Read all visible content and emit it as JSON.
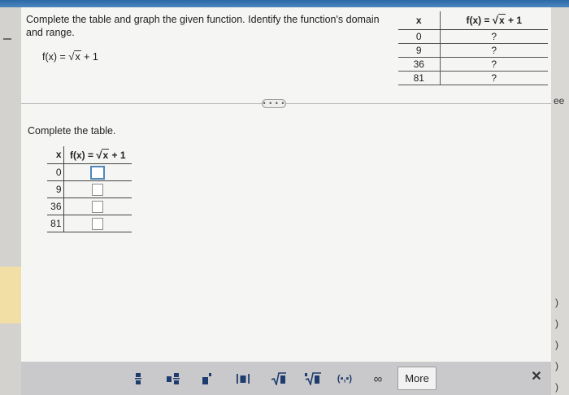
{
  "question": {
    "prompt": "Complete the table and graph the given function. Identify the function's domain and range.",
    "function_prefix": "f(x) = ",
    "function_radicand": "x",
    "function_suffix": " + 1"
  },
  "reference_table": {
    "col_x": "x",
    "col_fx_prefix": "f(x) = ",
    "col_fx_radicand": "x",
    "col_fx_suffix": " + 1",
    "rows": [
      {
        "x": "0",
        "y": "?"
      },
      {
        "x": "9",
        "y": "?"
      },
      {
        "x": "36",
        "y": "?"
      },
      {
        "x": "81",
        "y": "?"
      }
    ]
  },
  "more_pill": "• • • •",
  "answer_section": {
    "label": "Complete the table.",
    "col_x": "x",
    "col_fx_prefix": "f(x) = ",
    "col_fx_radicand": "x",
    "col_fx_suffix": " + 1",
    "rows": [
      {
        "x": "0"
      },
      {
        "x": "9"
      },
      {
        "x": "36"
      },
      {
        "x": "81"
      }
    ]
  },
  "toolbar": {
    "tools": [
      "fraction-icon",
      "mixed-number-icon",
      "exponent-icon",
      "absolute-value-icon",
      "square-root-icon",
      "nth-root-icon",
      "ordered-pair-icon",
      "infinity-icon"
    ],
    "pair_label": "(▪,▪)",
    "infinity_label": "∞",
    "more_label": "More",
    "close_label": "✕"
  },
  "right_edge": {
    "top_text": "ee",
    "marks": [
      ")",
      ")",
      ")",
      ")",
      ")"
    ]
  }
}
